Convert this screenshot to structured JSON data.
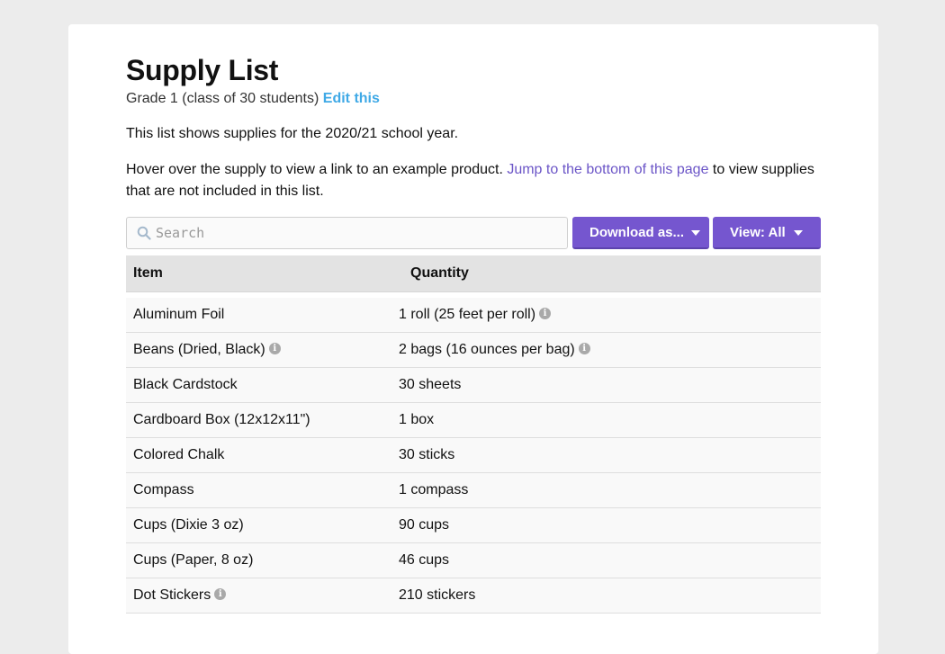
{
  "header": {
    "title": "Supply List",
    "subtitle": "Grade 1 (class of 30 students)",
    "edit_link": "Edit this"
  },
  "intro": {
    "line1": "This list shows supplies for the 2020/21 school year.",
    "line2_before": "Hover over the supply to view a link to an example product. ",
    "line2_link": "Jump to the bottom of this page",
    "line2_after": " to view supplies that are not included in this list."
  },
  "toolbar": {
    "search_placeholder": "Search",
    "download_label": "Download as...",
    "view_label": "View: All"
  },
  "table": {
    "columns": [
      "Item",
      "Quantity"
    ],
    "rows": [
      {
        "item": "Aluminum Foil",
        "item_info": false,
        "quantity": "1 roll (25 feet per roll)",
        "quantity_info": true
      },
      {
        "item": "Beans (Dried, Black)",
        "item_info": true,
        "quantity": "2 bags (16 ounces per bag)",
        "quantity_info": true
      },
      {
        "item": "Black Cardstock",
        "item_info": false,
        "quantity": "30 sheets",
        "quantity_info": false
      },
      {
        "item": "Cardboard Box (12x12x11\")",
        "item_info": false,
        "quantity": "1 box",
        "quantity_info": false
      },
      {
        "item": "Colored Chalk",
        "item_info": false,
        "quantity": "30 sticks",
        "quantity_info": false
      },
      {
        "item": "Compass",
        "item_info": false,
        "quantity": "1 compass",
        "quantity_info": false
      },
      {
        "item": "Cups (Dixie 3 oz)",
        "item_info": false,
        "quantity": "90 cups",
        "quantity_info": false
      },
      {
        "item": "Cups (Paper, 8 oz)",
        "item_info": false,
        "quantity": "46 cups",
        "quantity_info": false
      },
      {
        "item": "Dot Stickers",
        "item_info": true,
        "quantity": "210 stickers",
        "quantity_info": false
      }
    ]
  },
  "icons": {
    "info_glyph": "i"
  },
  "colors": {
    "accent": "#7556cf",
    "edit_link": "#3fa9e6",
    "jump_link": "#6b55c7",
    "header_bg": "#e3e3e3",
    "row_bg": "#f9f9f9"
  }
}
